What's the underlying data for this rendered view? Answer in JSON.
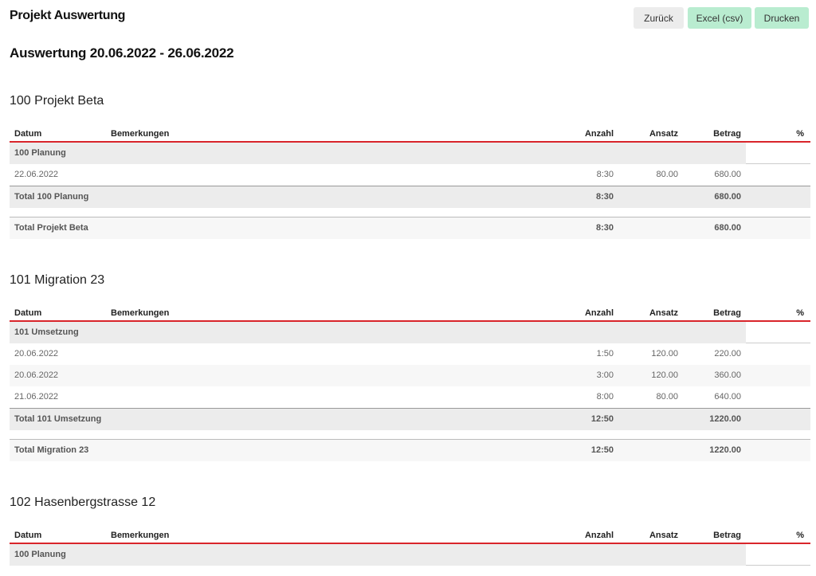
{
  "header": {
    "title": "Projekt Auswertung",
    "buttons": {
      "back": "Zurück",
      "excel": "Excel (csv)",
      "print": "Drucken"
    }
  },
  "range_title": "Auswertung 20.06.2022 - 26.06.2022",
  "columns": {
    "datum": "Datum",
    "bemerkungen": "Bemerkungen",
    "anzahl": "Anzahl",
    "ansatz": "Ansatz",
    "betrag": "Betrag",
    "pct": "%"
  },
  "colors": {
    "accent_red": "#d9252b",
    "button_green": "#b9ecd0",
    "button_grey": "#ececec"
  },
  "projects": [
    {
      "title": "100 Projekt Beta",
      "groups": [
        {
          "name": "100 Planung",
          "rows": [
            {
              "datum": "22.06.2022",
              "anzahl": "8:30",
              "ansatz": "80.00",
              "betrag": "680.00"
            }
          ],
          "total": {
            "label": "Total 100 Planung",
            "anzahl": "8:30",
            "betrag": "680.00"
          }
        }
      ],
      "total": {
        "label": "Total Projekt Beta",
        "anzahl": "8:30",
        "betrag": "680.00"
      }
    },
    {
      "title": "101 Migration 23",
      "groups": [
        {
          "name": "101 Umsetzung",
          "rows": [
            {
              "datum": "20.06.2022",
              "anzahl": "1:50",
              "ansatz": "120.00",
              "betrag": "220.00"
            },
            {
              "datum": "20.06.2022",
              "anzahl": "3:00",
              "ansatz": "120.00",
              "betrag": "360.00"
            },
            {
              "datum": "21.06.2022",
              "anzahl": "8:00",
              "ansatz": "80.00",
              "betrag": "640.00"
            }
          ],
          "total": {
            "label": "Total 101 Umsetzung",
            "anzahl": "12:50",
            "betrag": "1220.00"
          }
        }
      ],
      "total": {
        "label": "Total Migration 23",
        "anzahl": "12:50",
        "betrag": "1220.00"
      }
    },
    {
      "title": "102 Hasenbergstrasse 12",
      "groups": [
        {
          "name": "100 Planung"
        }
      ]
    }
  ]
}
